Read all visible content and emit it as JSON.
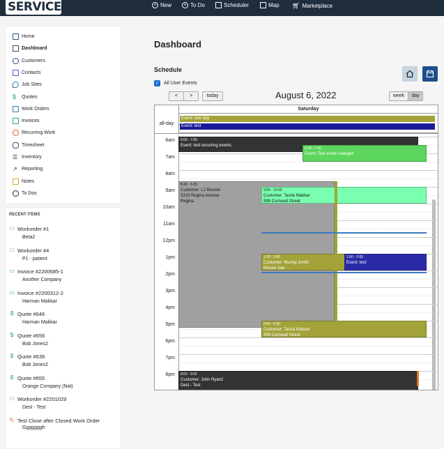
{
  "app": {
    "logo": "SERVICEBOX"
  },
  "topnav": [
    {
      "label": "New",
      "icon": "plus-circle-icon"
    },
    {
      "label": "To Do",
      "icon": "plus-circle-icon"
    },
    {
      "label": "Scheduler",
      "icon": "calendar-icon"
    },
    {
      "label": "Map",
      "icon": "map-icon"
    },
    {
      "label": "Marketplace",
      "icon": "cart-icon"
    }
  ],
  "sidebar": {
    "items": [
      {
        "label": "Home",
        "icon": "home-icon"
      },
      {
        "label": "Dashboard",
        "icon": "dashboard-icon",
        "active": true
      },
      {
        "label": "Customers",
        "icon": "users-icon"
      },
      {
        "label": "Contacts",
        "icon": "contacts-icon"
      },
      {
        "label": "Job Sites",
        "icon": "map-pin-icon"
      },
      {
        "label": "Quotes",
        "icon": "dollar-icon"
      },
      {
        "label": "Work Orders",
        "icon": "document-icon"
      },
      {
        "label": "Invoices",
        "icon": "invoice-icon"
      },
      {
        "label": "Recurring Work",
        "icon": "recurring-icon"
      },
      {
        "label": "Timesheet",
        "icon": "watch-icon"
      },
      {
        "label": "Inventory",
        "icon": "list-icon"
      },
      {
        "label": "Reporting",
        "icon": "trend-icon"
      },
      {
        "label": "Notes",
        "icon": "note-icon"
      },
      {
        "label": "To Dos",
        "icon": "clock-icon"
      }
    ]
  },
  "recent": {
    "title": "RECENT ITEMS",
    "items": [
      {
        "title": "Workorder #1",
        "sub": "Beta2",
        "icon": "document-icon"
      },
      {
        "title": "Workorder #4",
        "sub": "P1 - patient",
        "icon": "document-icon"
      },
      {
        "title": "Invoice #2200685-1",
        "sub": "Another Company",
        "icon": "invoice-icon"
      },
      {
        "title": "Invoice #2200312-2",
        "sub": "Harman Makkar",
        "icon": "invoice-icon"
      },
      {
        "title": "Quote #646",
        "sub": "Harman Makkar",
        "icon": "dollar-icon"
      },
      {
        "title": "Quote #656",
        "sub": "Bob Jones2",
        "icon": "dollar-icon"
      },
      {
        "title": "Quote #639",
        "sub": "Bob Jones2",
        "icon": "dollar-icon"
      },
      {
        "title": "Quote #655",
        "sub": "Orange Company (Nat)",
        "icon": "dollar-icon"
      },
      {
        "title": "Workorder #2201029",
        "sub": "Dest - Test",
        "icon": "document-icon"
      },
      {
        "title": "Test Close after Closed Work Order",
        "sub": "Gggggggh",
        "icon": "recurring-icon"
      }
    ]
  },
  "main": {
    "title": "Dashboard",
    "schedule_title": "Schedule",
    "all_user_events": "All User Events",
    "today": "today",
    "prev": "<",
    "next": ">",
    "date": "August 6, 2022",
    "week": "week",
    "day": "day",
    "day_header": "Saturday",
    "all_day_label": "all-day"
  },
  "calendar": {
    "all_day_events": [
      {
        "title": "Event: sick day",
        "color": "#a3a33a"
      },
      {
        "title": "Event: test",
        "color": "#1a1a99"
      }
    ],
    "hours": [
      "6am",
      "7am",
      "8am",
      "9am",
      "10am",
      "11am",
      "12pm",
      "1pm",
      "2pm",
      "3pm",
      "4pm",
      "5pm",
      "6pm",
      "7pm",
      "8pm"
    ],
    "events": [
      {
        "time": "6:00 - 7:00",
        "lines": [
          "Event: test recurring events"
        ],
        "color": "#333333",
        "text": "#ffffff"
      },
      {
        "time": "6:30 - 7:30",
        "lines": [
          "Event: Test event changed"
        ],
        "color": "#5cd65c",
        "text": "#ffffff"
      },
      {
        "time": "8:40 - 5:25",
        "lines": [
          "Customer: LJ Moonie",
          "3315 Regina Avenue",
          "Regina"
        ],
        "color": "#a0a0a0",
        "text": "#111111"
      },
      {
        "time": "9:00 - 10:00",
        "lines": [
          "Customer: Tasha Makkar",
          "999 Cornwall Street"
        ],
        "color": "#7affb0",
        "text": "#111111"
      },
      {
        "time": "1:00 - 2:00",
        "lines": [
          "Customer: Murray Smith",
          "Moose Jaw"
        ],
        "color": "#a3a33a",
        "text": "#ffffff"
      },
      {
        "time": "1:00 - 2:00",
        "lines": [
          "Event: test"
        ],
        "color": "#2b2ba8",
        "text": "#ffffff"
      },
      {
        "time": "5:00 - 6:00",
        "lines": [
          "Customer: Tasha Makkar",
          "999 Cornwall Street"
        ],
        "color": "#a3a33a",
        "text": "#ffffff"
      },
      {
        "time": "8:02 - 9:02",
        "lines": [
          "Customer: John Ryan2",
          "Dest - Test"
        ],
        "color": "#333333",
        "text": "#ffffff"
      }
    ]
  }
}
